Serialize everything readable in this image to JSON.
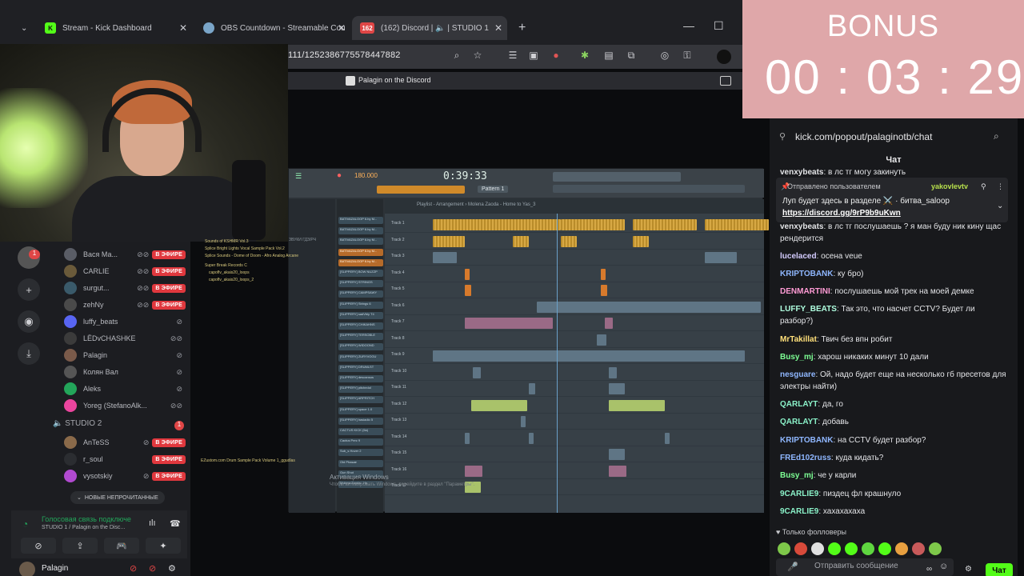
{
  "browser": {
    "tabs": [
      {
        "title": "Stream - Kick Dashboard",
        "fav": "K",
        "color": "#53fc18"
      },
      {
        "title": "OBS Countdown - Streamable Cou",
        "fav": "",
        "color": "#7aa5c8"
      },
      {
        "title": "(162) Discord | 🔈 | STUDIO 1",
        "fav": "162",
        "color": "#e04646"
      }
    ],
    "url": "111/1252386775578447882"
  },
  "discord": {
    "top_title": "Palagin on the Discord",
    "voice_users": [
      {
        "name": "Вася Ма...",
        "live": "В ЭФИРЕ"
      },
      {
        "name": "CARLIE",
        "live": "В ЭФИРЕ"
      },
      {
        "name": "surgut...",
        "live": "В ЭФИРЕ"
      },
      {
        "name": "zehNy",
        "live": "В ЭФИРЕ"
      },
      {
        "name": "luffy_beats",
        "live": ""
      },
      {
        "name": "LЁDvCHASHKE",
        "live": ""
      },
      {
        "name": "Palagin",
        "live": ""
      },
      {
        "name": "Колян Вал",
        "live": ""
      },
      {
        "name": "Aleks",
        "live": ""
      },
      {
        "name": "Yoreg (StefanoAlk...",
        "live": ""
      }
    ],
    "studio2": "STUDIO 2",
    "studio2_badge": "1",
    "studio2_users": [
      {
        "name": "AnTeSS",
        "live": "В ЭФИРЕ"
      },
      {
        "name": "r_soul",
        "live": "В ЭФИРЕ"
      },
      {
        "name": "vysotskiy",
        "live": "В ЭФИРЕ"
      }
    ],
    "unread": "НОВЫЕ НЕПРОЧИТАННЫЕ",
    "voice_status": "Голосовая связь подключе",
    "voice_sub": "STUDIO 1 / Palagin on the Disc...",
    "user": "Palagin",
    "server_badge": "1"
  },
  "fl": {
    "time": "0:39:33",
    "bpm": "180.000",
    "pattern": "Pattern 1",
    "playlist_title": "Playlist - Arrangement › Molena Zaoda - Home to Yas_3",
    "browser_tabs": "ЗВУКИ  ГДЗ/РЧ",
    "packs": [
      "Sounds of KSHMR Vol.3",
      "Splice Bright Lights Vocal Sample Pack Vol.2",
      "Splice Sounds - Dome of Doom - Afro Analog Arcane",
      "Super Break Records C",
      "capoflv_akais20_loops",
      "capoflv_akais20_loops_2",
      "EZustom.com Drum Sample Pack Volume 1_ggudlas"
    ],
    "tracks": [
      "Track 1",
      "Track 2",
      "Track 3",
      "Track 4",
      "Track 5",
      "Track 6",
      "Track 7",
      "Track 8",
      "Track 9",
      "Track 10",
      "Track 11",
      "Track 12",
      "Track 13",
      "Track 14",
      "Track 15",
      "Track 16",
      "Track 17"
    ],
    "channels": [
      "BATIVAZALOOP 6.by M...",
      "BATIVAZALOOP 6.by M...",
      "BATIVAZALOOP 6.by M...",
      "BATIVAZALOOP 6.by M...",
      "BATIVAZALOOP 6.by M...",
      "[SLIPPERY] BOW NUZZP",
      "[SLIPPERY] STRINGS",
      "[SLIPPERY] CAMPSAWY",
      "[SLIPPERY] Strings 6",
      "[SLIPPERY] sadVbly T4",
      "[SLIPPERY] CHIKAHNS",
      "[SLIPPERY] TERSOBLE",
      "[SLIPPERY] WIDOOND",
      "[SLIPPERY] ZURYVOGU",
      "[SLIPPERY] DRUMLST",
      "[SLIPPERY] descansos",
      "[SLIPPERY] pitchedol",
      "[SLIPPERY] ARPRITCH",
      "[SLIPPERY] space 1.0",
      "[SLIPPERY] hasiadio 5",
      "CACTUS KICK (5a)",
      "Cactus Perc 9",
      "Sub_s Hover 2",
      "Old Phasae",
      "Gun Shot",
      "Molena Zaoda - Ho"
    ],
    "watermark": "Активация Windows",
    "watermark_sub": "Чтобы активировать Windows, перейдите в раздел \"Параметры\"."
  },
  "bonus": {
    "label": "BONUS",
    "timer": "00 : 03 : 29",
    "color": "#dfa7a9"
  },
  "chat": {
    "url": "kick.com/popout/palaginotb/chat",
    "title": "Чат",
    "pinned_by": "Отправлено пользователем",
    "pinned_user": "yakovlevtv",
    "pinned_text": "Луп будет здесь в разделе ⚔️ · битва_saloop",
    "pinned_link": "https://discord.gg/9rP9b9uKwn",
    "messages": [
      {
        "user": "venxybeats",
        "color": "#e4e5e8",
        "text": ": в лс тг могу закинуть"
      },
      {
        "user": "venxybeats",
        "color": "#e4e5e8",
        "text": ": в лс тг послушаешь ? я ман буду ник кину щас рендерится"
      },
      {
        "user": "lucelaced",
        "color": "#d4ccff",
        "text": ": осена veue"
      },
      {
        "user": "KRIPTOBANK",
        "color": "#8fb7ff",
        "text": ": ку бро)"
      },
      {
        "user": "DENMARTINI",
        "color": "#ff9bd5",
        "text": ": послушаешь мой трек на моей демке"
      },
      {
        "user": "LUFFY_BEATS",
        "color": "#b0ffe0",
        "text": ": Так это, что насчет CCTV? Будет ли разбор?)"
      },
      {
        "user": "MrTakillat",
        "color": "#ffe07a",
        "text": ": Твич без впн робит"
      },
      {
        "user": "Busy_mj",
        "color": "#7dff94",
        "text": ": харош никаких минут 10 дали"
      },
      {
        "user": "nesguare",
        "color": "#8fb7ff",
        "text": ": Ой, надо будет еще на несколько гб пресетов для электры найти)"
      },
      {
        "user": "QARLAYT",
        "color": "#8af1c8",
        "text": ": да, го"
      },
      {
        "user": "QARLAYT",
        "color": "#8af1c8",
        "text": ": добавь"
      },
      {
        "user": "KRIPTOBANK",
        "color": "#8fb7ff",
        "text": ": на CCTV будет разбор?"
      },
      {
        "user": "FREd102russ",
        "color": "#8fb7ff",
        "text": ": куда кидать?"
      },
      {
        "user": "Busy_mj",
        "color": "#7dff94",
        "text": ": че у карли"
      },
      {
        "user": "9CARLIE9",
        "color": "#8af1c8",
        "text": ": пиздец фл крашнуло"
      },
      {
        "user": "9CARLIE9",
        "color": "#8af1c8",
        "text": ": хахахахаха"
      }
    ],
    "followers": "Только фолловеры",
    "input_placeholder": "Отправить сообщение",
    "send": "Чат",
    "accent": "#53fc18"
  }
}
